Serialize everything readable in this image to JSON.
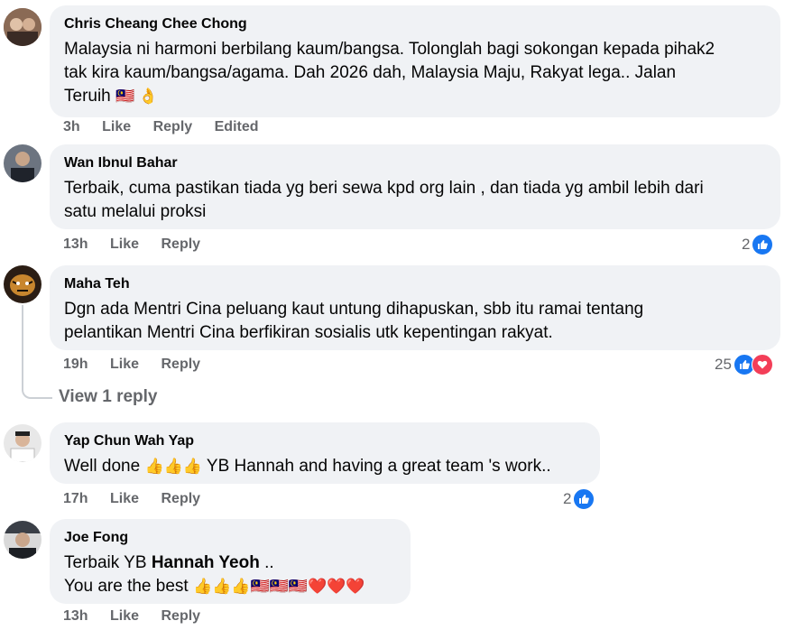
{
  "comments": [
    {
      "author": "Chris Cheang Chee Chong",
      "text_line1": "Malaysia ni harmoni berbilang kaum/bangsa. Tolonglah bagi sokongan kepada pihak2",
      "text_line2": "tak kira kaum/bangsa/agama. Dah 2026 dah, Malaysia Maju, Rakyat lega.. Jalan",
      "text_line3": "Teruih",
      "emojis": "🇲🇾 👌",
      "time": "3h",
      "like_label": "Like",
      "reply_label": "Reply",
      "edited_label": "Edited",
      "avatar_color": "#6b4b3e"
    },
    {
      "author": "Wan Ibnul Bahar",
      "text_line1": "Terbaik, cuma pastikan tiada yg beri sewa kpd org lain , dan tiada yg ambil lebih dari",
      "text_line2": "satu melalui proksi",
      "time": "13h",
      "like_label": "Like",
      "reply_label": "Reply",
      "reaction_count": "2",
      "avatar_color": "#4a4f59"
    },
    {
      "author": "Maha Teh",
      "text_line1": "Dgn ada Mentri Cina peluang kaut untung dihapuskan, sbb itu ramai tentang",
      "text_line2": "pelantikan Mentri Cina berfikiran sosialis utk kepentingan rakyat.",
      "time": "19h",
      "like_label": "Like",
      "reply_label": "Reply",
      "reaction_count": "25",
      "view_replies": "View 1 reply",
      "avatar_color": "#3b2a1f"
    },
    {
      "author": "Yap Chun Wah Yap",
      "text_before": "Well done",
      "emojis": "👍👍👍",
      "text_after": "YB Hannah and having a great team 's work..",
      "time": "17h",
      "like_label": "Like",
      "reply_label": "Reply",
      "reaction_count": "2",
      "avatar_color": "#c9c9c9"
    },
    {
      "author": "Joe Fong",
      "line1_prefix": "Terbaik YB",
      "line1_bold": "Hannah Yeoh",
      "line1_suffix": "..",
      "line2_text": "You are the best",
      "line2_emojis": "👍👍👍🇲🇾🇲🇾🇲🇾❤️❤️❤️",
      "time": "13h",
      "like_label": "Like",
      "reply_label": "Reply",
      "avatar_color": "#2e3136"
    }
  ],
  "colors": {
    "bubble_bg": "#f0f2f5",
    "meta_text": "#65676b",
    "like_blue": "#1877f2",
    "love_red": "#f33e58"
  },
  "icons": [
    "like-icon",
    "love-icon"
  ]
}
